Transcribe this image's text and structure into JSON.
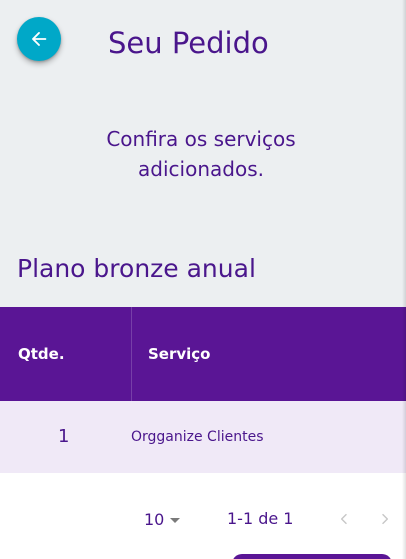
{
  "header": {
    "title": "Seu Pedido",
    "back_icon": "arrow-left-icon"
  },
  "intro": {
    "line1": "Confira os serviços",
    "line2": "adicionados."
  },
  "plan": {
    "name": "Plano bronze anual"
  },
  "table": {
    "columns": {
      "qty": "Qtde.",
      "service": "Serviço"
    },
    "rows": [
      {
        "qty": "1",
        "service": "Orgganize Clientes"
      }
    ]
  },
  "paginator": {
    "page_size": "10",
    "range": "1-1 de 1"
  },
  "colors": {
    "background": "#eceff1",
    "accent": "#00a8c8",
    "primary": "#5a1595",
    "text": "#4a168c",
    "row_highlight": "#f0e9f7"
  }
}
